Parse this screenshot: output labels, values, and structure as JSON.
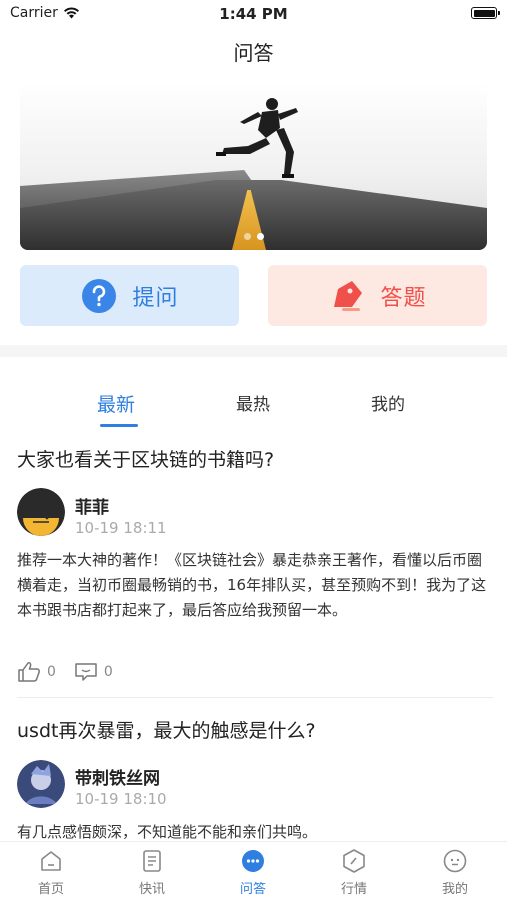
{
  "status": {
    "carrier": "Carrier",
    "time": "1:44 PM"
  },
  "nav": {
    "title": "问答"
  },
  "banner": {
    "page_count": 2,
    "active_index": 1
  },
  "quick_actions": {
    "ask_label": "提问",
    "answer_label": "答题"
  },
  "tabs": [
    {
      "label": "最新",
      "active": true
    },
    {
      "label": "最热",
      "active": false
    },
    {
      "label": "我的",
      "active": false
    }
  ],
  "posts": [
    {
      "title": "大家也看关于区块链的书籍吗?",
      "author": "菲菲",
      "time": "10-19 18:11",
      "body": "推荐一本大神的著作！《区块链社会》暴走恭亲王著作，看懂以后币圈横着走，当初币圈最畅销的书，16年排队买，甚至预购不到！我为了这本书跟书店都打起来了，最后答应给我预留一本。",
      "likes": "0",
      "comments": "0"
    },
    {
      "title": "usdt再次暴雷，最大的触感是什么?",
      "author": "带刺铁丝网",
      "time": "10-19 18:10",
      "body": "有几点感悟颇深，不知道能不能和亲们共鸣。"
    }
  ],
  "tabbar": [
    {
      "label": "首页",
      "icon": "home-icon"
    },
    {
      "label": "快讯",
      "icon": "news-icon"
    },
    {
      "label": "问答",
      "icon": "qa-icon",
      "active": true
    },
    {
      "label": "行情",
      "icon": "market-icon"
    },
    {
      "label": "我的",
      "icon": "profile-icon"
    }
  ],
  "colors": {
    "accent": "#2f7fe0",
    "answer_accent": "#f0504a"
  }
}
